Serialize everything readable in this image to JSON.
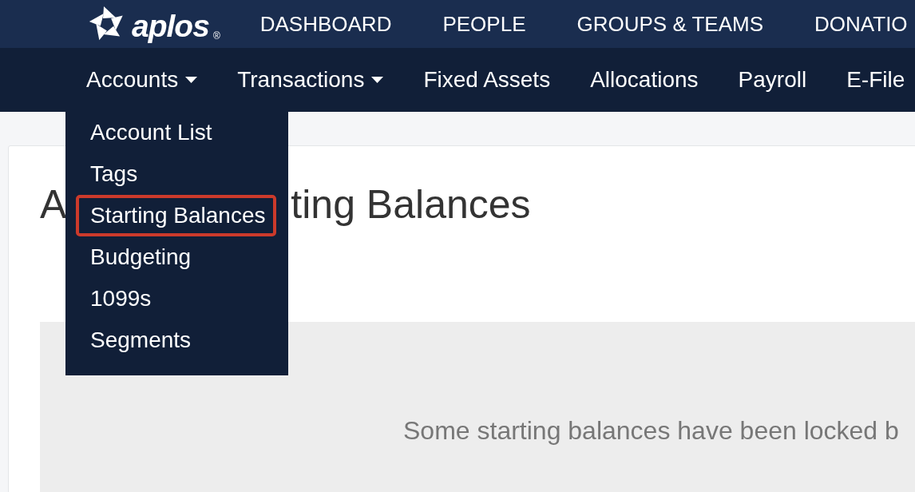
{
  "top_nav": {
    "logo": {
      "name": "aplos",
      "mark": "®"
    },
    "items": [
      {
        "label": "DASHBOARD"
      },
      {
        "label": "PEOPLE"
      },
      {
        "label": "GROUPS & TEAMS"
      },
      {
        "label": "DONATIO"
      }
    ]
  },
  "sub_nav": {
    "items": [
      {
        "label": "Accounts",
        "has_menu": true,
        "menu": [
          {
            "label": "Account List",
            "highlighted": false
          },
          {
            "label": "Tags",
            "highlighted": false
          },
          {
            "label": "Starting Balances",
            "highlighted": true
          },
          {
            "label": "Budgeting",
            "highlighted": false
          },
          {
            "label": "1099s",
            "highlighted": false
          },
          {
            "label": "Segments",
            "highlighted": false
          }
        ]
      },
      {
        "label": "Transactions",
        "has_menu": true
      },
      {
        "label": "Fixed Assets",
        "has_menu": false
      },
      {
        "label": "Allocations",
        "has_menu": false
      },
      {
        "label": "Payroll",
        "has_menu": false
      },
      {
        "label": "E-File",
        "has_menu": false
      }
    ]
  },
  "page": {
    "heading_parts": [
      "A",
      "ting Balances"
    ],
    "notice": "Some starting balances have been locked b"
  }
}
